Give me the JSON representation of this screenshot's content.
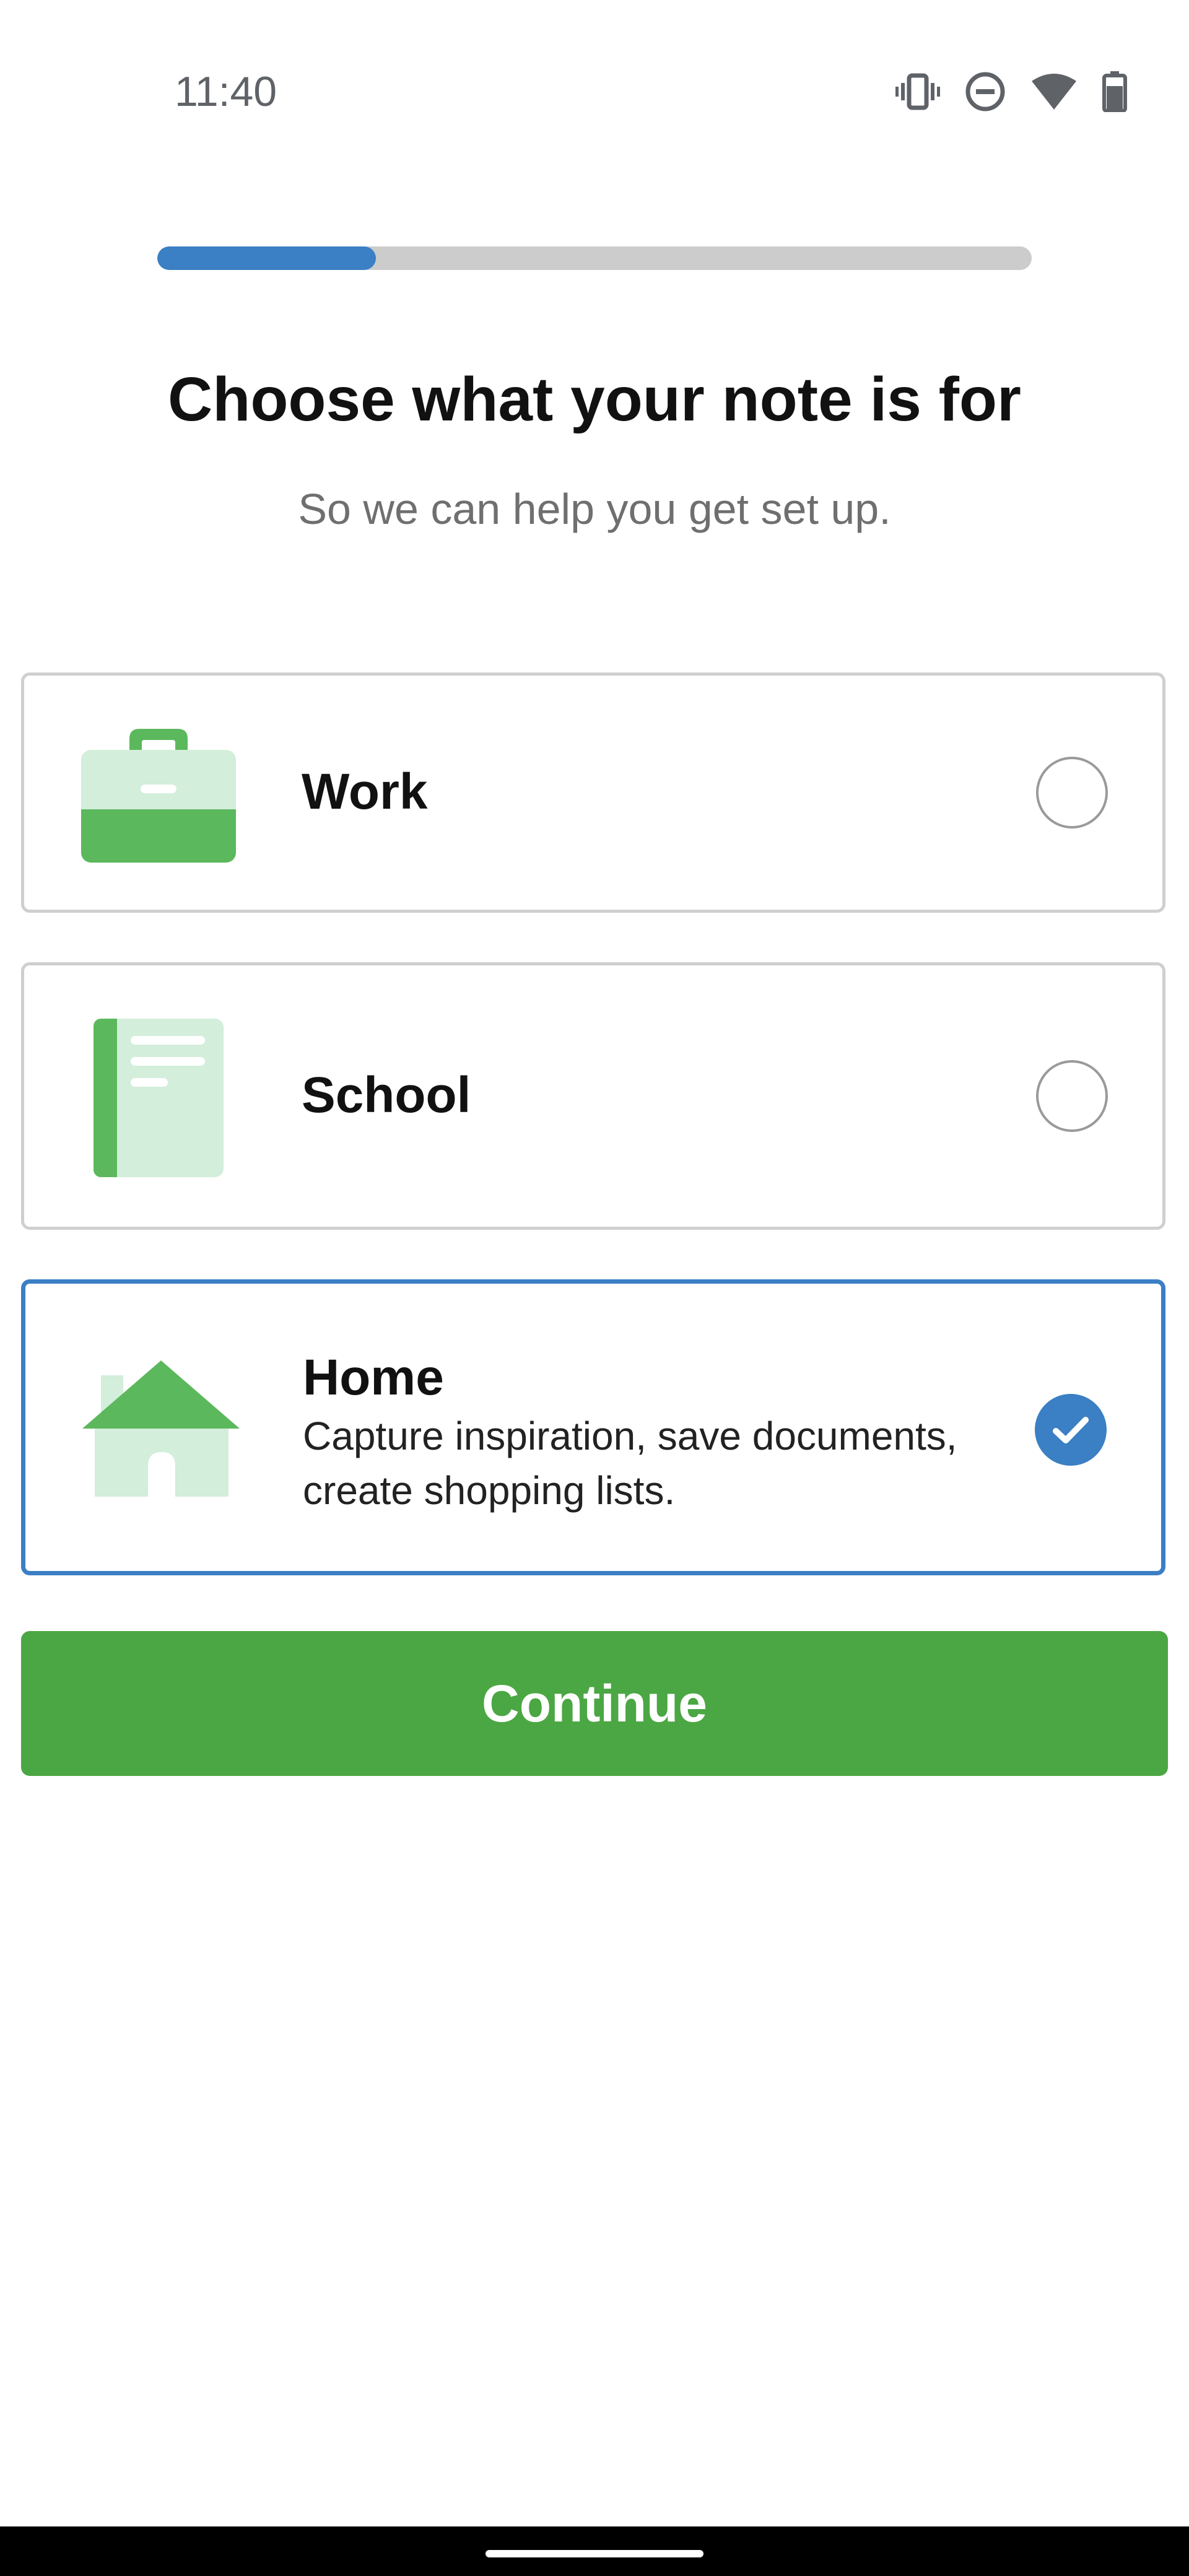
{
  "status_bar": {
    "time": "11:40",
    "icons": [
      "vibrate-icon",
      "do-not-disturb-icon",
      "wifi-icon",
      "battery-icon"
    ]
  },
  "progress": {
    "fraction": 0.25,
    "color": "#3b7fc4"
  },
  "heading": {
    "title": "Choose what your note is for",
    "subtitle": "So we can help you get set up."
  },
  "options": [
    {
      "label": "Work",
      "icon": "briefcase-icon",
      "selected": false,
      "description": ""
    },
    {
      "label": "School",
      "icon": "notebook-icon",
      "selected": false,
      "description": ""
    },
    {
      "label": "Home",
      "icon": "house-icon",
      "selected": true,
      "description": "Capture inspiration, save documents, create shopping lists."
    }
  ],
  "continue_button": {
    "label": "Continue",
    "color": "#4ba743"
  },
  "colors": {
    "accent_blue": "#3b7fc4",
    "brand_green": "#4ba743",
    "icon_green_dark": "#5cb85c",
    "icon_green_light": "#d3eedb"
  }
}
